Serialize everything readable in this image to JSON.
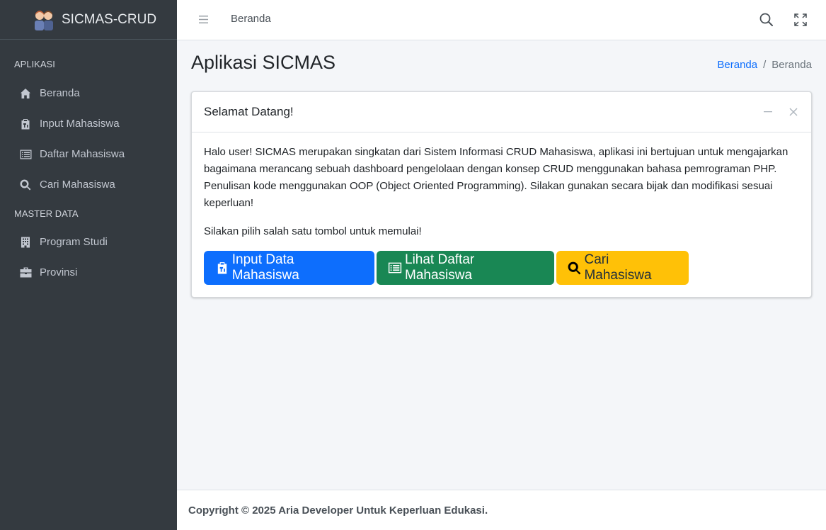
{
  "brand": {
    "name": "SICMAS-CRUD"
  },
  "sidebar": {
    "sections": [
      {
        "header": "APLIKASI",
        "items": [
          {
            "label": "Beranda",
            "icon": "home-icon"
          },
          {
            "label": "Input Mahasiswa",
            "icon": "clipboard-icon"
          },
          {
            "label": "Daftar Mahasiswa",
            "icon": "list-icon"
          },
          {
            "label": "Cari Mahasiswa",
            "icon": "search-icon"
          }
        ]
      },
      {
        "header": "MASTER DATA",
        "items": [
          {
            "label": "Program Studi",
            "icon": "building-icon"
          },
          {
            "label": "Provinsi",
            "icon": "briefcase-icon"
          }
        ]
      }
    ]
  },
  "topbar": {
    "link": "Beranda"
  },
  "page": {
    "title": "Aplikasi SICMAS"
  },
  "breadcrumb": {
    "items": [
      "Beranda",
      "Beranda"
    ],
    "separator": "/"
  },
  "card": {
    "title": "Selamat Datang!",
    "paragraph1": "Halo user! SICMAS merupakan singkatan dari Sistem Informasi CRUD Mahasiswa, aplikasi ini bertujuan untuk mengajarkan bagaimana merancang sebuah dashboard pengelolaan dengan konsep CRUD menggunakan bahasa pemrograman PHP. Penulisan kode menggunakan OOP (Object Oriented Programming). Silakan gunakan secara bijak dan modifikasi sesuai keperluan!",
    "paragraph2": "Silakan pilih salah satu tombol untuk memulai!",
    "buttons": [
      {
        "label": "Input Data Mahasiswa",
        "color": "#0d6efd"
      },
      {
        "label": "Lihat Daftar Mahasiswa",
        "color": "#198754"
      },
      {
        "label": "Cari Mahasiswa",
        "color": "#ffc107"
      }
    ]
  },
  "footer": {
    "text": "Copyright © 2025 Aria Developer Untuk Keperluan Edukasi."
  },
  "colors": {
    "sidebar": "#343a40",
    "primary": "#0d6efd",
    "success": "#198754",
    "warning": "#ffc107",
    "background": "#f4f6f9"
  }
}
